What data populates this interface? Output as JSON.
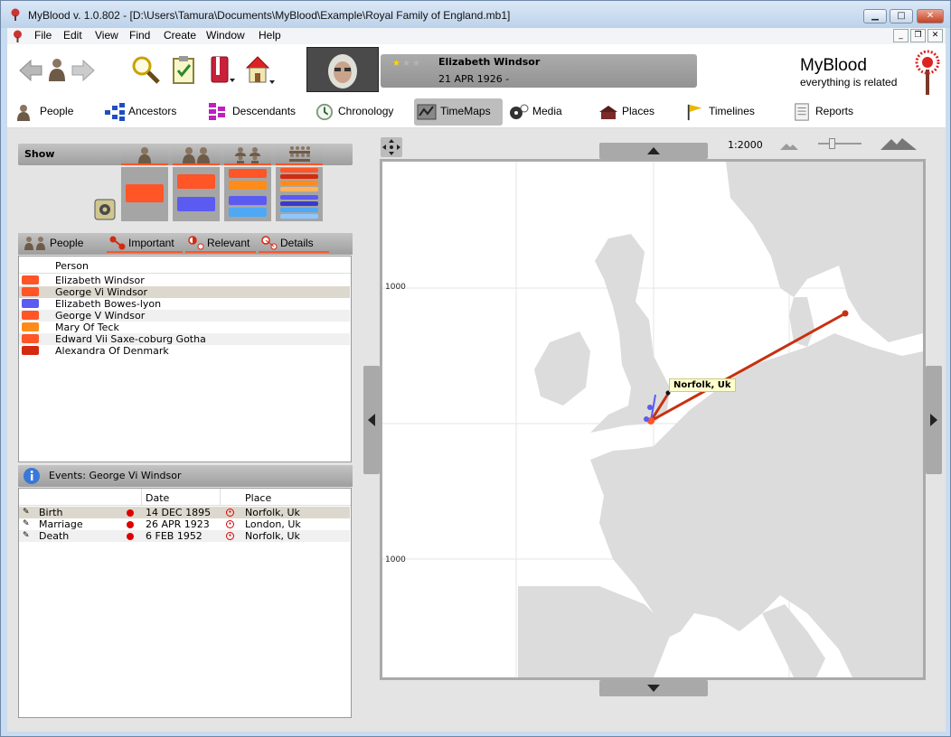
{
  "window": {
    "title": "MyBlood v. 1.0.802 - [D:\\Users\\Tamura\\Documents\\MyBlood\\Example\\Royal Family of England.mb1]"
  },
  "menu": [
    "File",
    "Edit",
    "View",
    "Find",
    "Create",
    "Window",
    "Help"
  ],
  "person_header": {
    "name": "Elizabeth Windsor",
    "dates": "21 APR 1926 -"
  },
  "brand": {
    "name": "MyBlood",
    "tagline": "everything is related"
  },
  "tabs": [
    "People",
    "Ancestors",
    "Descendants",
    "Chronology",
    "TimeMaps",
    "Media",
    "Places",
    "Timelines",
    "Reports"
  ],
  "show": {
    "label": "Show"
  },
  "people_panel": {
    "tabs": [
      "People",
      "Important",
      "Relevant",
      "Details"
    ],
    "column": "Person",
    "rows": [
      {
        "name": "Elizabeth Windsor",
        "color": "#ff5527"
      },
      {
        "name": "George Vi Windsor",
        "color": "#ff5527"
      },
      {
        "name": "Elizabeth Bowes-lyon",
        "color": "#5b5bf2"
      },
      {
        "name": "George V Windsor",
        "color": "#ff5527"
      },
      {
        "name": "Mary Of Teck",
        "color": "#ff8c1a"
      },
      {
        "name": "Edward Vii Saxe-coburg  Gotha",
        "color": "#ff5527"
      },
      {
        "name": "Alexandra Of Denmark",
        "color": "#d42a10"
      }
    ]
  },
  "events_panel": {
    "title": "Events: George Vi Windsor",
    "columns": [
      "Date",
      "Place"
    ],
    "rows": [
      {
        "event": "Birth",
        "date": "14 DEC 1895",
        "place": "Norfolk, Uk"
      },
      {
        "event": "Marriage",
        "date": "26 APR 1923",
        "place": "London, Uk"
      },
      {
        "event": "Death",
        "date": "6 FEB 1952",
        "place": "Norfolk, Uk"
      }
    ]
  },
  "map": {
    "scale": "1:2000",
    "grid_label_top": "1000",
    "grid_label_bottom": "1000",
    "tooltip": "Norfolk, Uk"
  }
}
